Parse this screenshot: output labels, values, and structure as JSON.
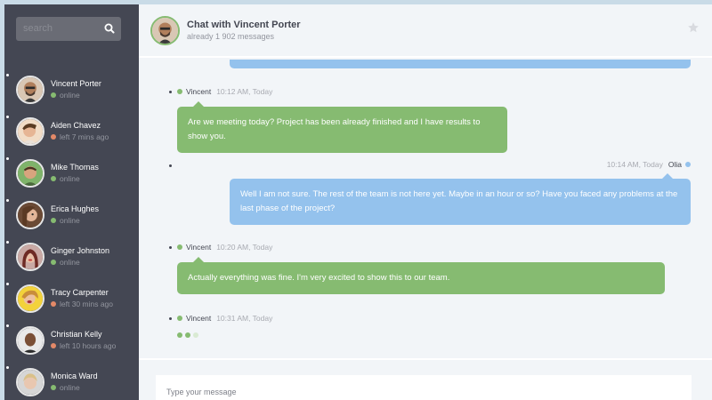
{
  "colors": {
    "sidebar_bg": "#444753",
    "chat_bg": "#f2f5f8",
    "online": "#86bb71",
    "away": "#e38968",
    "my_bubble": "#94c2ed",
    "other_bubble": "#86bb71"
  },
  "sidebar": {
    "search": {
      "placeholder": "search",
      "icon": "search-icon"
    },
    "people": [
      {
        "name": "Vincent Porter",
        "status": "online",
        "state": "online"
      },
      {
        "name": "Aiden Chavez",
        "status": "left 7 mins ago",
        "state": "away"
      },
      {
        "name": "Mike Thomas",
        "status": "online",
        "state": "online"
      },
      {
        "name": "Erica Hughes",
        "status": "online",
        "state": "online"
      },
      {
        "name": "Ginger Johnston",
        "status": "online",
        "state": "online"
      },
      {
        "name": "Tracy Carpenter",
        "status": "left 30 mins ago",
        "state": "away"
      },
      {
        "name": "Christian Kelly",
        "status": "left 10 hours ago",
        "state": "away"
      },
      {
        "name": "Monica Ward",
        "status": "online",
        "state": "online"
      }
    ]
  },
  "chat": {
    "title": "Chat with Vincent Porter",
    "subtitle": "already 1 902 messages",
    "favorite_icon": "star-icon",
    "messages": [
      {
        "author": "Vincent",
        "time": "10:12 AM, Today",
        "text": "Are we meeting today? Project has been already finished and I have results to show you.",
        "mine": false
      },
      {
        "author": "Olia",
        "time": "10:14 AM, Today",
        "text": "Well I am not sure. The rest of the team is not here yet. Maybe in an hour or so? Have you faced any problems at the last phase of the project?",
        "mine": true
      },
      {
        "author": "Vincent",
        "time": "10:20 AM, Today",
        "text": "Actually everything was fine. I'm very excited to show this to our team.",
        "mine": false
      },
      {
        "author": "Vincent",
        "time": "10:31 AM, Today",
        "text": "",
        "mine": false
      }
    ],
    "composer": {
      "placeholder": "Type your message"
    }
  }
}
